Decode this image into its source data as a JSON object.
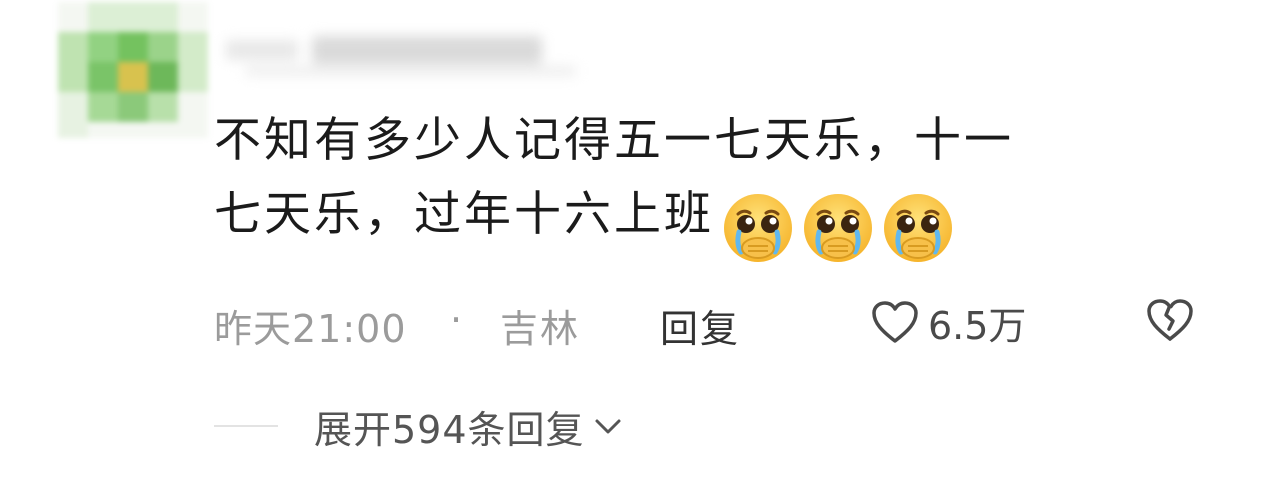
{
  "comment": {
    "text_line1": "不知有多少人记得五一七天乐，十一",
    "text_line2": "七天乐，过年十六上班",
    "emojis": [
      "crying-face-emoji",
      "crying-face-emoji",
      "crying-face-emoji"
    ]
  },
  "meta": {
    "time": "昨天21:00",
    "separator": "·",
    "location": "吉林",
    "reply_label": "回复",
    "like_count": "6.5万"
  },
  "replies": {
    "expand_label": "展开594条回复"
  },
  "colors": {
    "text": "#1b1b1b",
    "meta": "#9b9b9b",
    "avatar_green": "#7bc86c",
    "avatar_yellow": "#d8c24e"
  }
}
